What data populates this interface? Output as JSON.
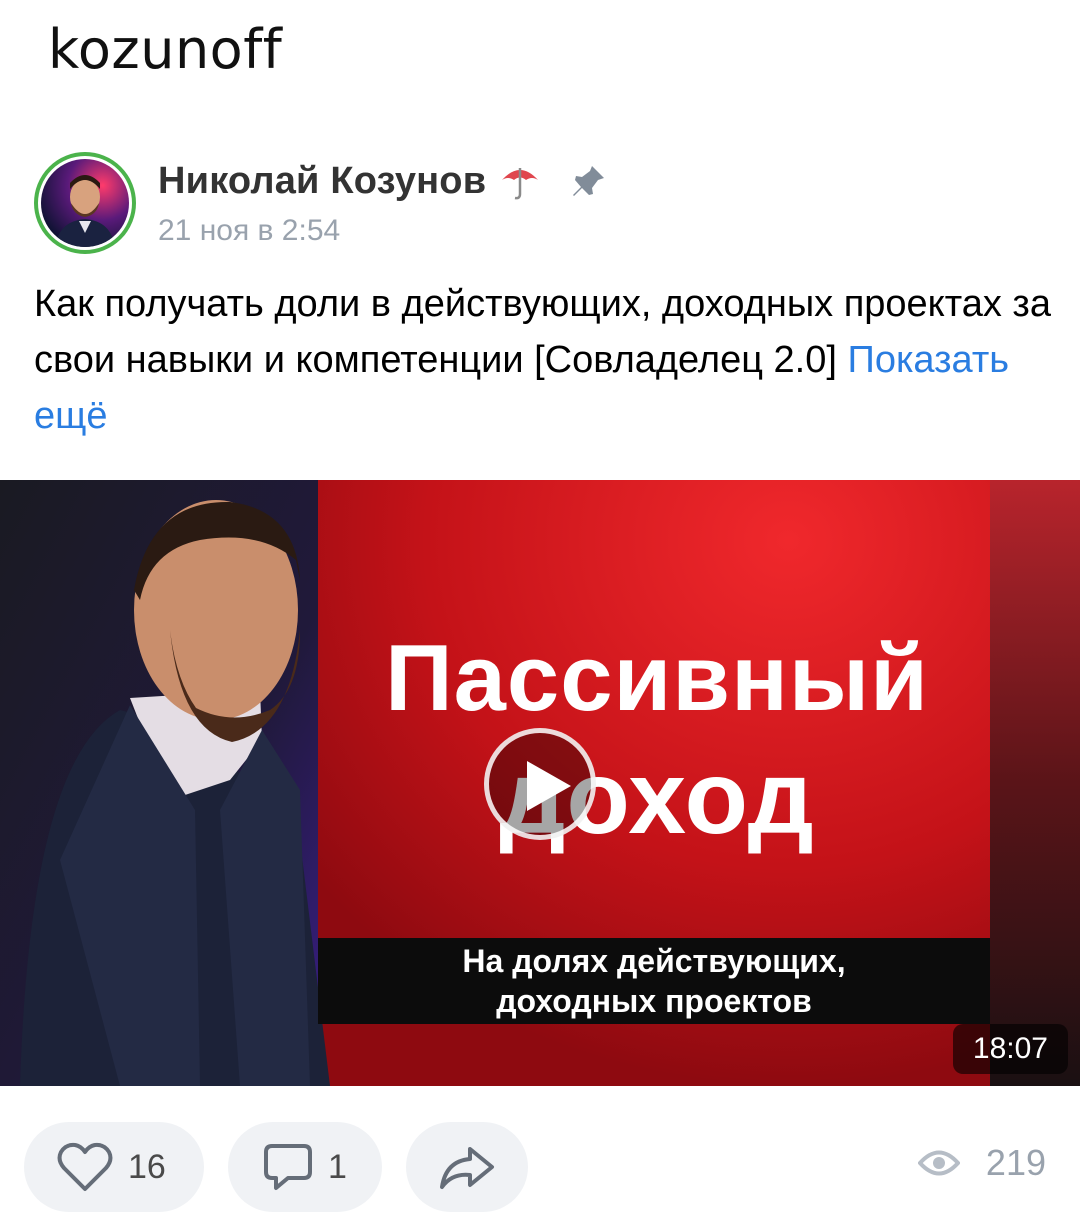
{
  "header": {
    "title": "kozunoff"
  },
  "post": {
    "author": "Николай Козунов",
    "date": "21 ноя в 2:54",
    "text": "Как получать доли в действующих, доходных проектах за свои навыки и компетенции [Совладелец 2.0]",
    "more_link": "Показать ещё"
  },
  "video": {
    "title_line1": "Пассивный",
    "title_line2": "доход",
    "subtitle_line1": "На долях действующих,",
    "subtitle_line2": "доходных проектов",
    "duration": "18:07"
  },
  "actions": {
    "likes": "16",
    "comments": "1",
    "views": "219"
  },
  "colors": {
    "accent_link": "#2a7de1",
    "avatar_ring": "#4bb34b",
    "video_red": "#d4161c",
    "muted_text": "#99a2ad"
  },
  "icons": [
    "umbrella-icon",
    "pin-icon",
    "play-icon",
    "heart-icon",
    "comment-icon",
    "share-icon",
    "eye-icon"
  ]
}
